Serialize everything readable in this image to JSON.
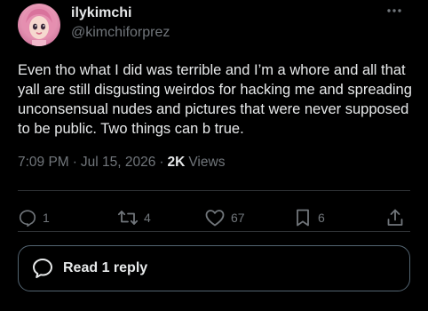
{
  "post": {
    "author": {
      "display_name": "ilykimchi",
      "handle": "@kimchiforprez",
      "avatar": "pink-haired-doll-avatar"
    },
    "text": "Even tho what I did was terrible and I’m a whore and all that yall are still disgusting weirdos for hacking me and spreading unconsensual nudes and pictures that were never supposed to be public. Two things can b true.",
    "time": "7:09 PM",
    "separator": "·",
    "date": "Jul 15, 2026",
    "views_count": "2K",
    "views_label": "Views"
  },
  "actions": {
    "replies": {
      "icon": "reply-icon",
      "count": "1"
    },
    "reposts": {
      "icon": "repost-icon",
      "count": "4"
    },
    "likes": {
      "icon": "heart-icon",
      "count": "67"
    },
    "bookmarks": {
      "icon": "bookmark-icon",
      "count": "6"
    },
    "share": {
      "icon": "share-icon"
    }
  },
  "read_replies": {
    "icon": "speech-bubble-icon",
    "label": "Read 1 reply"
  },
  "more_menu": {
    "icon": "more-horizontal-icon"
  },
  "colors": {
    "background": "#000000",
    "text_primary": "#e7e9ea",
    "text_secondary": "#71767b",
    "divider": "#2f3336",
    "button_border": "#536471"
  }
}
